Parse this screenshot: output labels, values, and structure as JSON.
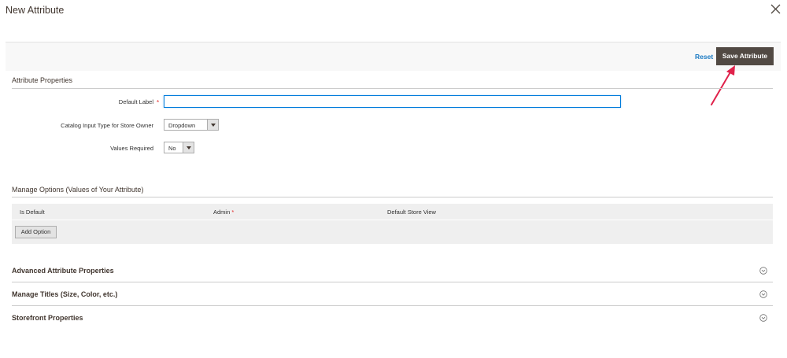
{
  "modal": {
    "title": "New Attribute",
    "close_icon": "close-icon"
  },
  "actions": {
    "reset_label": "Reset",
    "save_label": "Save Attribute"
  },
  "attribute_properties": {
    "section_title": "Attribute Properties",
    "default_label": {
      "label": "Default Label",
      "required_mark": "*",
      "value": ""
    },
    "input_type": {
      "label": "Catalog Input Type for Store Owner",
      "selected": "Dropdown"
    },
    "values_required": {
      "label": "Values Required",
      "selected": "No"
    }
  },
  "manage_options": {
    "section_title": "Manage Options (Values of Your Attribute)",
    "columns": {
      "is_default": "Is Default",
      "admin": "Admin",
      "admin_required_mark": "*",
      "store_view": "Default Store View"
    },
    "add_option_label": "Add Option"
  },
  "collapsibles": [
    {
      "title": "Advanced Attribute Properties",
      "icon": "chevron-circle-icon"
    },
    {
      "title": "Manage Titles (Size, Color, etc.)",
      "icon": "chevron-circle-icon"
    },
    {
      "title": "Storefront Properties",
      "icon": "chevron-circle-icon"
    }
  ],
  "colors": {
    "save_button_bg": "#514943",
    "link_blue": "#1979c3",
    "focus_border": "#007bdb",
    "required_red": "#e22626",
    "annotation_arrow": "#e0224b"
  }
}
